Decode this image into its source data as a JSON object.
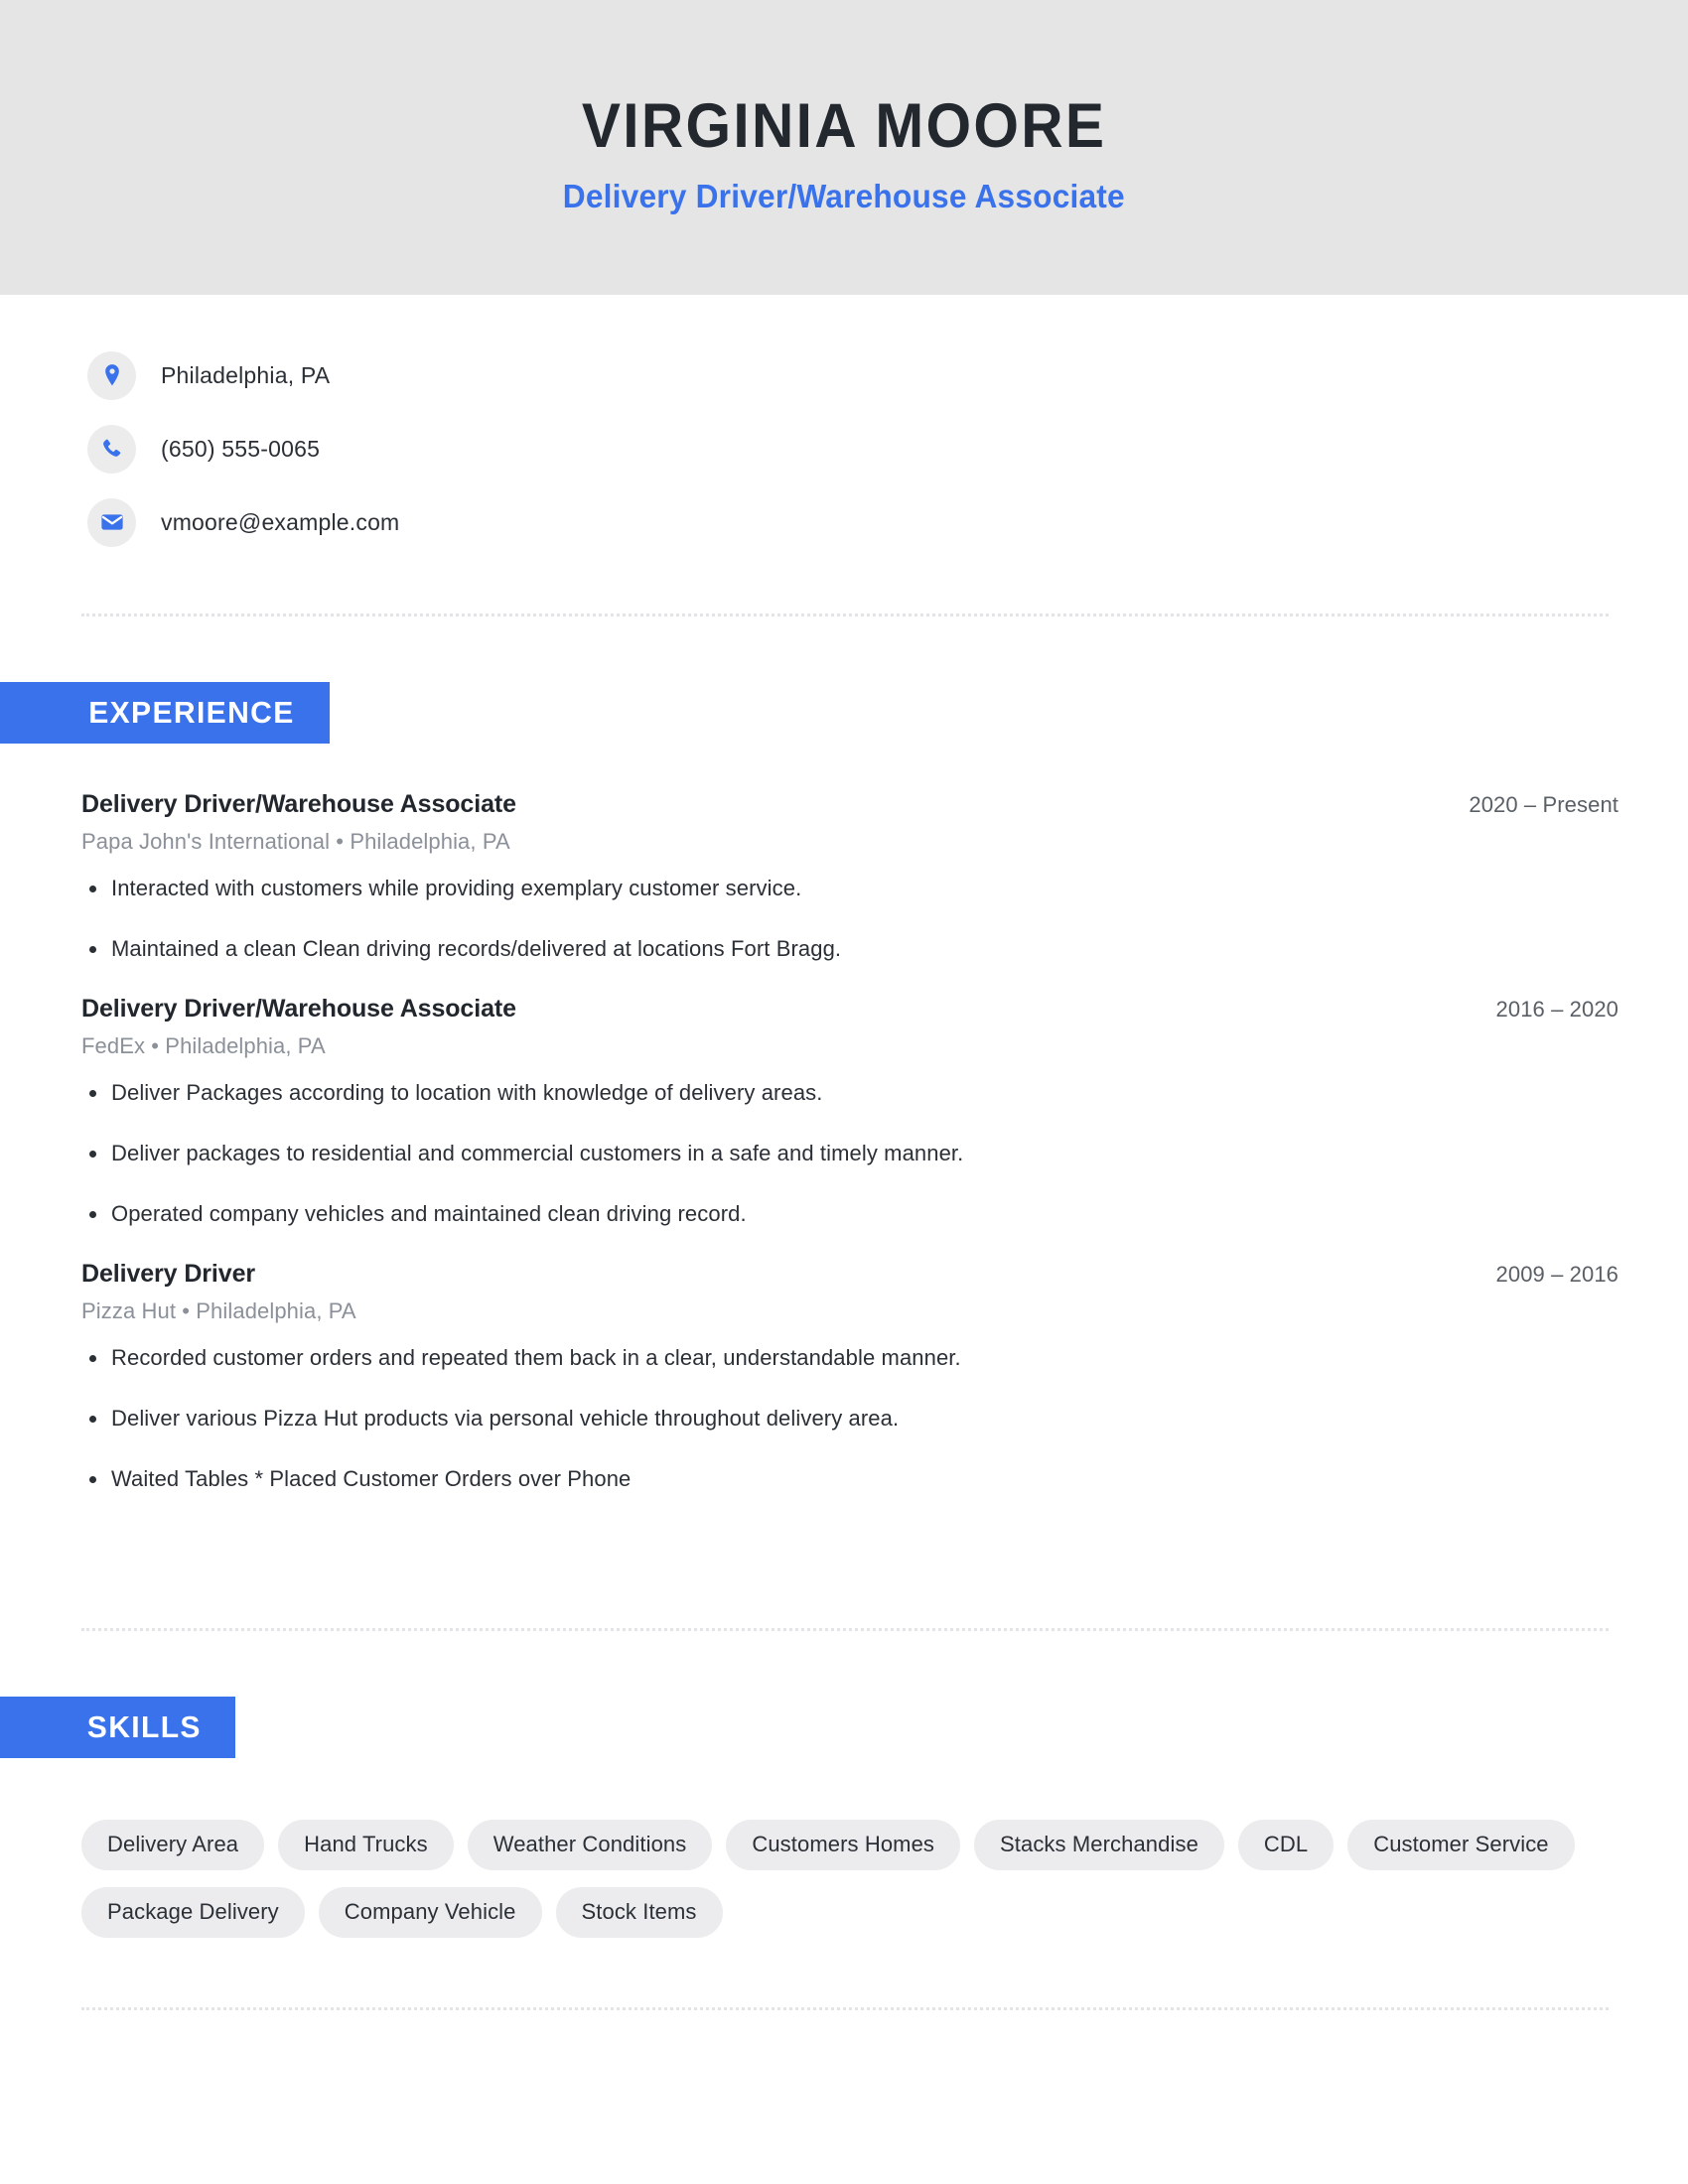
{
  "theme": {
    "accent_blue": "#3a72ec",
    "header_band_bg": "#e5e5e5",
    "pill_bg": "#ececee",
    "icon_circle_bg": "#ececec",
    "name_color": "#23272e",
    "muted_text": "#8b9099",
    "divider_color": "#e3e4e7"
  },
  "header": {
    "full_name": "VIRGINIA MOORE",
    "job_headline": "Delivery Driver/Warehouse Associate"
  },
  "contact": {
    "items": [
      {
        "icon": "location-pin-icon",
        "value": "Philadelphia, PA"
      },
      {
        "icon": "phone-icon",
        "value": "(650) 555-0065"
      },
      {
        "icon": "email-envelope-icon",
        "value": "vmoore@example.com"
      }
    ]
  },
  "sections": {
    "experience_label": "EXPERIENCE",
    "skills_label": "SKILLS"
  },
  "experience": {
    "jobs": [
      {
        "title": "Delivery Driver/Warehouse Associate",
        "company": "Papa John's International",
        "location": "Philadelphia, PA",
        "meta": "Papa John's International  •  Philadelphia, PA",
        "dates": "2020 – Present",
        "bullets": [
          "Interacted with customers while providing exemplary customer service.",
          "Maintained a clean Clean driving records/delivered at locations Fort Bragg."
        ]
      },
      {
        "title": "Delivery Driver/Warehouse Associate",
        "company": "FedEx",
        "location": "Philadelphia, PA",
        "meta": "FedEx  •  Philadelphia, PA",
        "dates": "2016 – 2020",
        "bullets": [
          "Deliver Packages according to location with knowledge of delivery areas.",
          "Deliver packages to residential and commercial customers in a safe and timely manner.",
          "Operated company vehicles and maintained clean driving record."
        ]
      },
      {
        "title": "Delivery Driver",
        "company": "Pizza Hut",
        "location": "Philadelphia, PA",
        "meta": "Pizza Hut  •  Philadelphia, PA",
        "dates": "2009 – 2016",
        "bullets": [
          "Recorded customer orders and repeated them back in a clear, understandable manner.",
          "Deliver various Pizza Hut products via personal vehicle throughout delivery area.",
          "Waited Tables * Placed Customer Orders over Phone"
        ]
      }
    ]
  },
  "skills": {
    "items": [
      "Delivery Area",
      "Hand Trucks",
      "Weather Conditions",
      "Customers Homes",
      "Stacks Merchandise",
      "CDL",
      "Customer Service",
      "Package Delivery",
      "Company Vehicle",
      "Stock Items"
    ]
  }
}
